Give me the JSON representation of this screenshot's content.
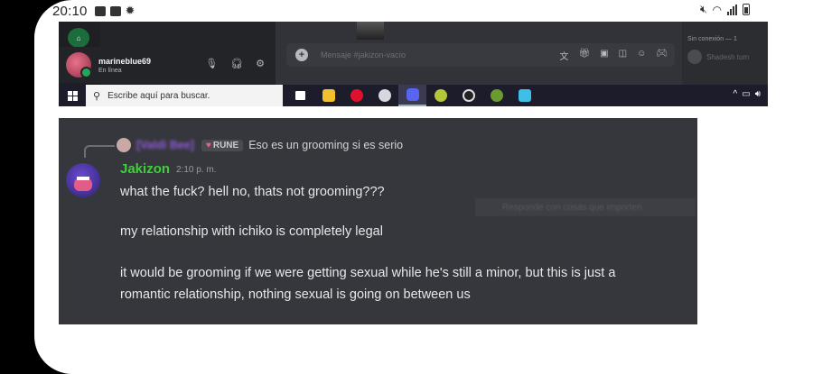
{
  "status_bar": {
    "time": "20:10"
  },
  "discord_top": {
    "username": "marineblue69",
    "user_status": "En línea",
    "message_placeholder": "Mensaje #jakizon-vacío",
    "members_header": "Sin conexión — 1",
    "member_name": "Shadesh tum"
  },
  "taskbar": {
    "search_placeholder": "Escribe aquí para buscar."
  },
  "message": {
    "reply_author": "[Valdi Bee]",
    "reply_tag": "RUNE",
    "reply_text": "Eso es un grooming si es serio",
    "author": "Jakizon",
    "timestamp": "2:10 p. m.",
    "lines": [
      "what the fuck? hell no, thats not grooming???",
      "my relationship with ichiko is completely legal",
      "it would be grooming if we were getting sexual while he's still a minor, but this is just a",
      "romantic relationship, nothing sexual is going on between us"
    ],
    "ghost_text": "Responde con cosas que importen"
  }
}
